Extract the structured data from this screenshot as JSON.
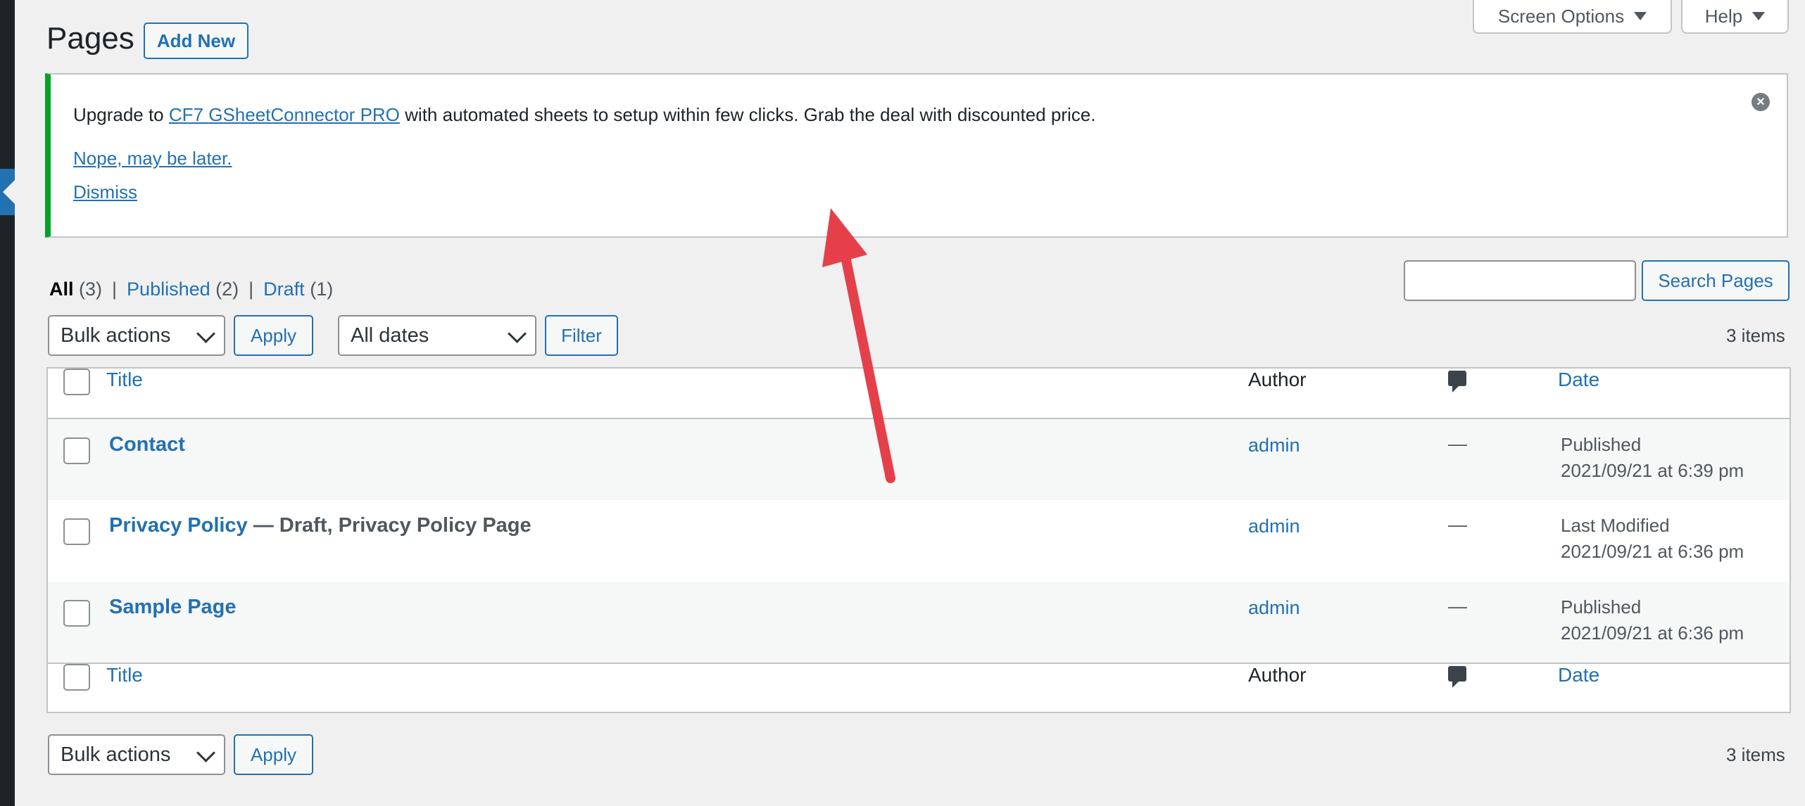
{
  "header": {
    "title": "Pages",
    "add_new": "Add New",
    "screen_options": "Screen Options",
    "help": "Help"
  },
  "notice": {
    "text_before": "Upgrade to ",
    "link": "CF7 GSheetConnector PRO",
    "text_after": " with automated sheets to setup within few clicks. Grab the deal with discounted price.",
    "later": "Nope, may be later.",
    "dismiss": "Dismiss",
    "close_icon": "×",
    "accent_color": "#00a32a"
  },
  "filters": {
    "all": "All",
    "all_count": "(3)",
    "published": "Published",
    "published_count": "(2)",
    "draft": "Draft",
    "draft_count": "(1)",
    "separator": "|"
  },
  "search": {
    "button": "Search Pages",
    "value": ""
  },
  "bulk": {
    "label": "Bulk actions",
    "apply": "Apply"
  },
  "dates": {
    "label": "All dates",
    "filter": "Filter"
  },
  "count": "3 items",
  "table": {
    "columns": {
      "title": "Title",
      "author": "Author",
      "date": "Date",
      "comments_icon": "comment-bubble"
    },
    "rows": [
      {
        "title": "Contact",
        "state": "",
        "author": "admin",
        "comments": "—",
        "status": "Published",
        "date": "2021/09/21 at 6:39 pm"
      },
      {
        "title": "Privacy Policy",
        "state": " — Draft, Privacy Policy Page",
        "author": "admin",
        "comments": "—",
        "status": "Last Modified",
        "date": "2021/09/21 at 6:36 pm"
      },
      {
        "title": "Sample Page",
        "state": "",
        "author": "admin",
        "comments": "—",
        "status": "Published",
        "date": "2021/09/21 at 6:36 pm"
      }
    ]
  },
  "colors": {
    "link": "#2271b1",
    "annotation_arrow": "#e5404a"
  }
}
